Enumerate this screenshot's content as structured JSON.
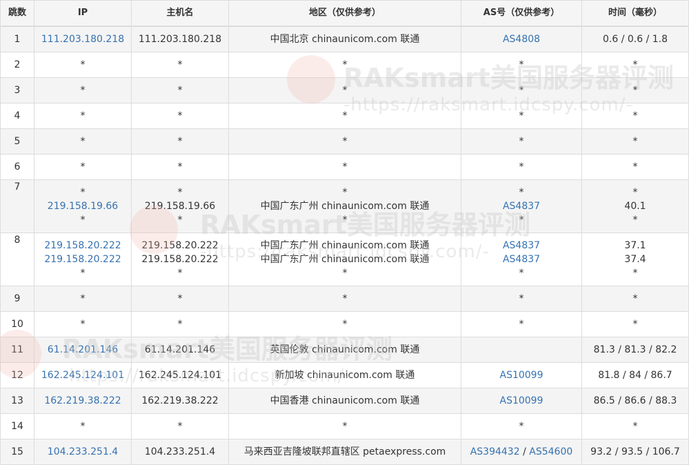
{
  "headers": {
    "hop": "跳数",
    "ip": "IP",
    "host": "主机名",
    "region": "地区（仅供参考）",
    "as": "AS号（仅供参考）",
    "time": "时间（毫秒）"
  },
  "rows": [
    {
      "hop": "1",
      "ip": "111.203.180.218",
      "host": "111.203.180.218",
      "region": "中国北京 chinaunicom.com 联通",
      "as": "AS4808",
      "time": "0.6 / 0.6 / 1.8"
    },
    {
      "hop": "2",
      "ip": "*",
      "host": "*",
      "region": "*",
      "as": "*",
      "time": "*"
    },
    {
      "hop": "3",
      "ip": "*",
      "host": "*",
      "region": "*",
      "as": "*",
      "time": "*"
    },
    {
      "hop": "4",
      "ip": "*",
      "host": "*",
      "region": "*",
      "as": "*",
      "time": "*"
    },
    {
      "hop": "5",
      "ip": "*",
      "host": "*",
      "region": "*",
      "as": "*",
      "time": "*"
    },
    {
      "hop": "6",
      "ip": "*",
      "host": "*",
      "region": "*",
      "as": "*",
      "time": "*"
    },
    {
      "hop": "7",
      "ip": [
        "*",
        "219.158.19.66",
        "*"
      ],
      "host": [
        "*",
        "219.158.19.66",
        "*"
      ],
      "region": [
        "*",
        "中国广东广州 chinaunicom.com 联通",
        "*"
      ],
      "as": [
        "*",
        "AS4837",
        "*"
      ],
      "time": [
        "*",
        "40.1",
        "*"
      ]
    },
    {
      "hop": "8",
      "ip": [
        "219.158.20.222",
        "219.158.20.222",
        "*"
      ],
      "host": [
        "219.158.20.222",
        "219.158.20.222",
        "*"
      ],
      "region": [
        "中国广东广州 chinaunicom.com 联通",
        "中国广东广州 chinaunicom.com 联通",
        "*"
      ],
      "as": [
        "AS4837",
        "AS4837",
        "*"
      ],
      "time": [
        "37.1",
        "37.4",
        "*"
      ]
    },
    {
      "hop": "9",
      "ip": "*",
      "host": "*",
      "region": "*",
      "as": "*",
      "time": "*"
    },
    {
      "hop": "10",
      "ip": "*",
      "host": "*",
      "region": "*",
      "as": "*",
      "time": "*"
    },
    {
      "hop": "11",
      "ip": "61.14.201.146",
      "host": "61.14.201.146",
      "region": "英国伦敦 chinaunicom.com 联通",
      "as": "",
      "time": "81.3 / 81.3 / 82.2"
    },
    {
      "hop": "12",
      "ip": "162.245.124.101",
      "host": "162.245.124.101",
      "region": "新加坡 chinaunicom.com 联通",
      "as": "AS10099",
      "time": "81.8 / 84 / 86.7"
    },
    {
      "hop": "13",
      "ip": "162.219.38.222",
      "host": "162.219.38.222",
      "region": "中国香港 chinaunicom.com 联通",
      "as": "AS10099",
      "time": "86.5 / 86.6 / 88.3"
    },
    {
      "hop": "14",
      "ip": "*",
      "host": "*",
      "region": "*",
      "as": "*",
      "time": "*"
    },
    {
      "hop": "15",
      "ip": "104.233.251.4",
      "host": "104.233.251.4",
      "region": "马来西亚吉隆坡联邦直辖区 petaexpress.com",
      "as": [
        "AS394432",
        "AS54600"
      ],
      "as_separator": " / ",
      "time": "93.2 / 93.5 / 106.7"
    }
  ],
  "watermark": {
    "title": "RAKsmart美国服务器评测",
    "url": "-https://raksmart.idcspy.com/-"
  },
  "colors": {
    "link": "#3572b0",
    "row_alt": "#f4f4f4",
    "border": "#dcdcdc",
    "text": "#333333"
  }
}
